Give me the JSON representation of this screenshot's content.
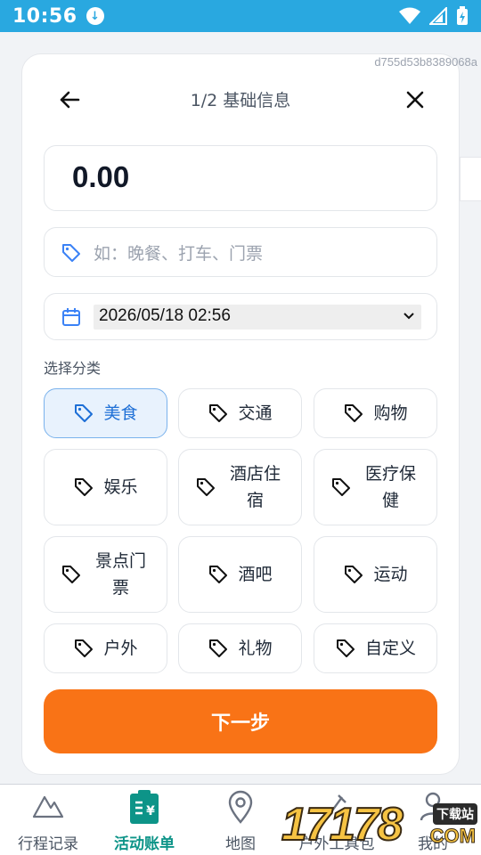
{
  "status_bar": {
    "time": "10:56"
  },
  "watermark_id": "d755d53b8389068a",
  "header": {
    "title": "1/2 基础信息"
  },
  "amount": {
    "value": "0.00"
  },
  "description": {
    "placeholder": "如：晚餐、打车、门票"
  },
  "date": {
    "value": "2026/05/18 02:56"
  },
  "category_section": {
    "label": "选择分类"
  },
  "categories": [
    {
      "label": "美食",
      "selected": true
    },
    {
      "label": "交通"
    },
    {
      "label": "购物"
    },
    {
      "label": "娱乐"
    },
    {
      "label": "酒店住宿"
    },
    {
      "label": "医疗保健"
    },
    {
      "label": "景点门票"
    },
    {
      "label": "酒吧"
    },
    {
      "label": "运动"
    },
    {
      "label": "户外"
    },
    {
      "label": "礼物"
    },
    {
      "label": "自定义"
    }
  ],
  "next_button": {
    "label": "下一步"
  },
  "bottom_nav": [
    {
      "label": "行程记录",
      "icon": "mountain-icon"
    },
    {
      "label": "活动账单",
      "icon": "receipt-icon",
      "active": true
    },
    {
      "label": "地图",
      "icon": "map-pin-icon"
    },
    {
      "label": "户外工具包",
      "icon": "tools-icon"
    },
    {
      "label": "我的",
      "icon": "person-icon"
    }
  ],
  "brand_watermark": {
    "digits": "17178",
    "tag": "下载站",
    "suffix": "COM"
  },
  "colors": {
    "status_bar": "#29a8e0",
    "accent_orange": "#f97316",
    "selected_blue": "#1d6fd6",
    "active_teal": "#0d9488"
  }
}
